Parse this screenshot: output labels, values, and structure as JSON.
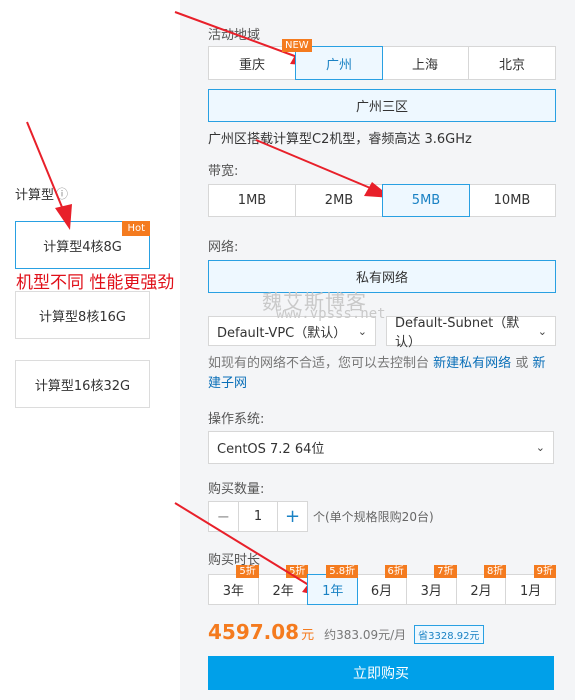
{
  "region": {
    "label": "活动地域",
    "new_badge": "NEW",
    "options": [
      "重庆",
      "广州",
      "上海",
      "北京"
    ],
    "selected_zone": "广州三区",
    "zone_note": "广州区搭载计算型C2机型，睿频高达 3.6GHz"
  },
  "bandwidth": {
    "label": "带宽:",
    "options": [
      "1MB",
      "2MB",
      "5MB",
      "10MB"
    ]
  },
  "network": {
    "label": "网络:",
    "type": "私有网络",
    "vpc": "Default-VPC（默认）",
    "subnet": "Default-Subnet（默认）",
    "hint_text": "如现有的网络不合适，您可以去控制台",
    "link1": "新建私有网络",
    "or": "或",
    "link2": "新建子网"
  },
  "os": {
    "label": "操作系统:",
    "value": "CentOS 7.2 64位"
  },
  "quantity": {
    "label": "购买数量:",
    "minus": "−",
    "value": "1",
    "plus": "+",
    "note": "个(单个规格限购20台)"
  },
  "duration": {
    "label": "购买时长",
    "options": [
      {
        "name": "3年",
        "tag": "5折"
      },
      {
        "name": "2年",
        "tag": "5折"
      },
      {
        "name": "1年",
        "tag": "5.8折"
      },
      {
        "name": "6月",
        "tag": "6折"
      },
      {
        "name": "3月",
        "tag": "7折"
      },
      {
        "name": "2月",
        "tag": "8折"
      },
      {
        "name": "1月",
        "tag": "9折"
      }
    ]
  },
  "price": {
    "amount": "4597.08",
    "unit": "元",
    "monthly": "约383.09元/月",
    "saving": "省3328.92元"
  },
  "buy_button": "立即购买",
  "instance": {
    "label": "计算型",
    "info_icon": "ⓘ",
    "hot_badge": "Hot",
    "cards": [
      "计算型4核8G",
      "计算型8核16G",
      "计算型16核32G"
    ],
    "annotation": "机型不同 性能更强劲"
  },
  "watermark": {
    "title": "魏艾斯博客",
    "url": "www.vpsss.net"
  },
  "colors": {
    "accent": "#29a0e2",
    "badge": "#f47b1f",
    "price": "#f47b1f",
    "annotation_red": "#e0101a",
    "arrow_red": "#e8202a",
    "buy_button": "#00a0e9"
  }
}
